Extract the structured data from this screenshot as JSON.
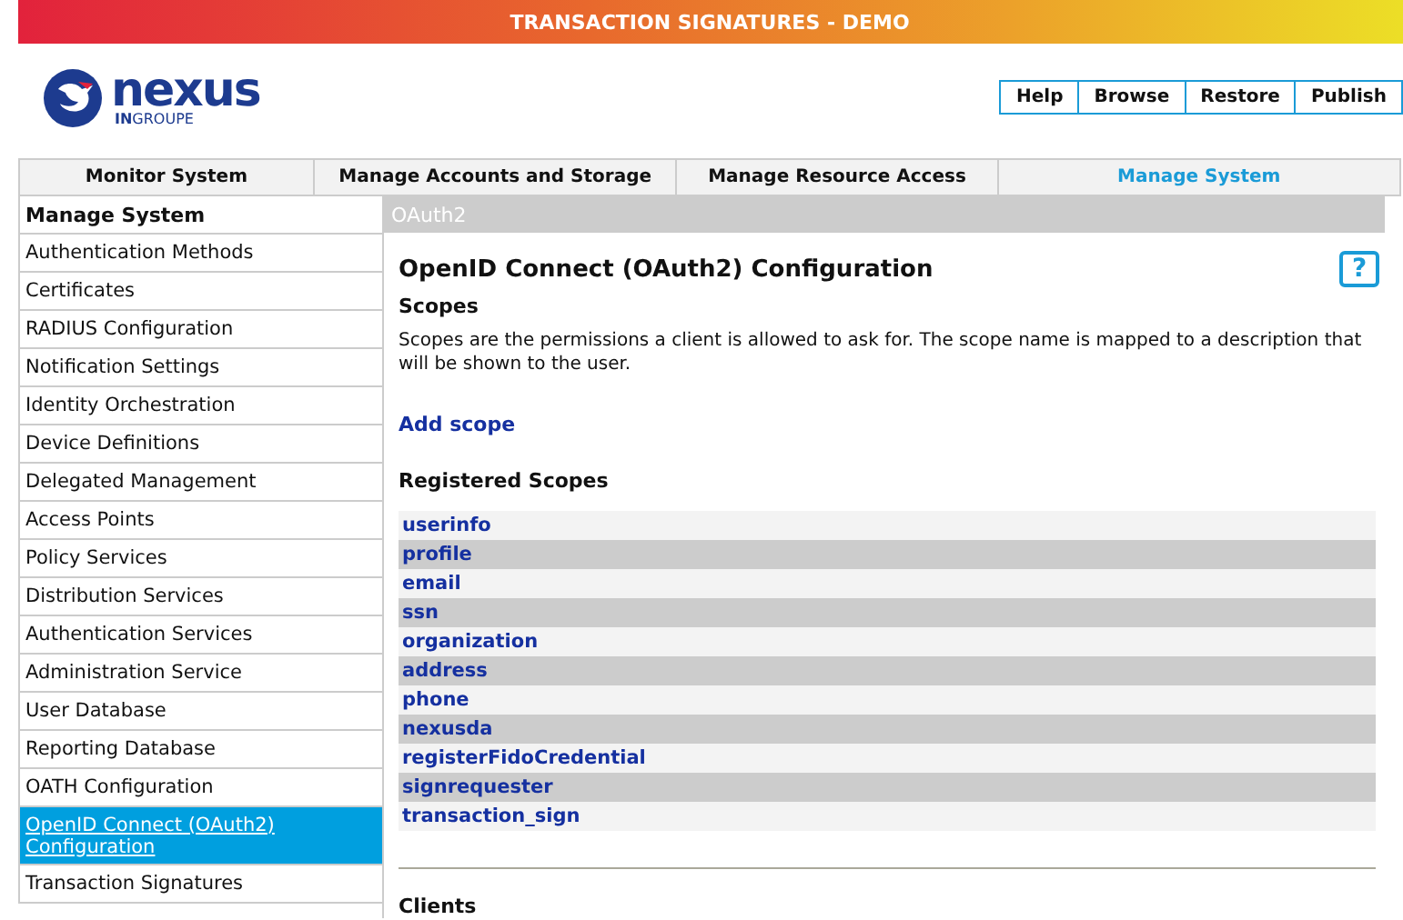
{
  "banner": {
    "title": "TRANSACTION SIGNATURES - DEMO"
  },
  "logo": {
    "name": "nexus",
    "sub_bold": "IN",
    "sub": "GROUPE"
  },
  "toolbar": [
    "Help",
    "Browse",
    "Restore",
    "Publish"
  ],
  "nav_tabs": [
    {
      "label": "Monitor System",
      "selected": false
    },
    {
      "label": "Manage Accounts and Storage",
      "selected": false
    },
    {
      "label": "Manage Resource Access",
      "selected": false
    },
    {
      "label": "Manage System",
      "selected": true
    }
  ],
  "sidebar": {
    "heading": "Manage System",
    "items": [
      {
        "label": "Authentication Methods",
        "selected": false
      },
      {
        "label": "Certificates",
        "selected": false
      },
      {
        "label": "RADIUS Configuration",
        "selected": false
      },
      {
        "label": "Notification Settings",
        "selected": false
      },
      {
        "label": "Identity Orchestration",
        "selected": false
      },
      {
        "label": "Device Definitions",
        "selected": false
      },
      {
        "label": "Delegated Management",
        "selected": false
      },
      {
        "label": "Access Points",
        "selected": false
      },
      {
        "label": "Policy Services",
        "selected": false
      },
      {
        "label": "Distribution Services",
        "selected": false
      },
      {
        "label": "Authentication Services",
        "selected": false
      },
      {
        "label": "Administration Service",
        "selected": false
      },
      {
        "label": "User Database",
        "selected": false
      },
      {
        "label": "Reporting Database",
        "selected": false
      },
      {
        "label": "OATH Configuration",
        "selected": false
      },
      {
        "label": "OpenID Connect (OAuth2) Configuration",
        "selected": true
      },
      {
        "label": "Transaction Signatures",
        "selected": false
      }
    ]
  },
  "content": {
    "breadcrumb": "OAuth2",
    "title": "OpenID Connect (OAuth2) Configuration",
    "help_button": "?",
    "scopes_heading": "Scopes",
    "description": "Scopes are the permissions a client is allowed to ask for. The scope name is mapped to a description that will be shown to the user.",
    "add_link": "Add scope",
    "registered_heading": "Registered Scopes",
    "scopes": [
      "userinfo",
      "profile",
      "email",
      "ssn",
      "organization",
      "address",
      "phone",
      "nexusda",
      "registerFidoCredential",
      "signrequester",
      "transaction_sign"
    ],
    "clients_heading": "Clients"
  }
}
